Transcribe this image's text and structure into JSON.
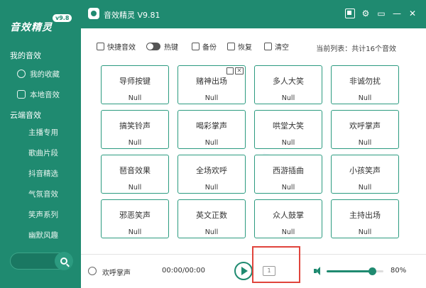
{
  "brand": {
    "logo_text": "音效精灵",
    "version_badge": "v9.8"
  },
  "window": {
    "title": "音效精灵 V9.81"
  },
  "sidebar": {
    "sections": [
      "我的音效",
      "云端音效"
    ],
    "my_items": [
      {
        "label": "我的收藏",
        "icon": "favorite-icon"
      },
      {
        "label": "本地音效",
        "icon": "local-folder-icon"
      }
    ],
    "cloud_items": [
      "主播专用",
      "歌曲片段",
      "抖音精选",
      "气氛音效",
      "笑声系列",
      "幽默风趣"
    ]
  },
  "toolbar": {
    "quick": "快捷音效",
    "hotkey": "热键",
    "backup": "备份",
    "restore": "恢复",
    "clear": "清空",
    "status": "当前列表：共计16个音效"
  },
  "cards": [
    {
      "name": "导师按键",
      "key": "Null"
    },
    {
      "name": "赌神出场",
      "key": "Null"
    },
    {
      "name": "多人大笑",
      "key": "Null"
    },
    {
      "name": "非诚勿扰",
      "key": "Null"
    },
    {
      "name": "搞笑铃声",
      "key": "Null"
    },
    {
      "name": "喝彩掌声",
      "key": "Null"
    },
    {
      "name": "哄堂大笑",
      "key": "Null"
    },
    {
      "name": "欢呼掌声",
      "key": "Null"
    },
    {
      "name": "琶音效果",
      "key": "Null"
    },
    {
      "name": "全场欢呼",
      "key": "Null"
    },
    {
      "name": "西游插曲",
      "key": "Null"
    },
    {
      "name": "小孩笑声",
      "key": "Null"
    },
    {
      "name": "邪恶笑声",
      "key": "Null"
    },
    {
      "name": "英文正数",
      "key": "Null"
    },
    {
      "name": "众人鼓掌",
      "key": "Null"
    },
    {
      "name": "主持出场",
      "key": "Null"
    }
  ],
  "player": {
    "now_playing": "欢呼掌声",
    "time": "00:00/00:00",
    "loop_label": "1",
    "volume_pct": "80%",
    "volume": 0.8
  },
  "colors": {
    "accent": "#1f8a70",
    "highlight": "#e0443c"
  }
}
